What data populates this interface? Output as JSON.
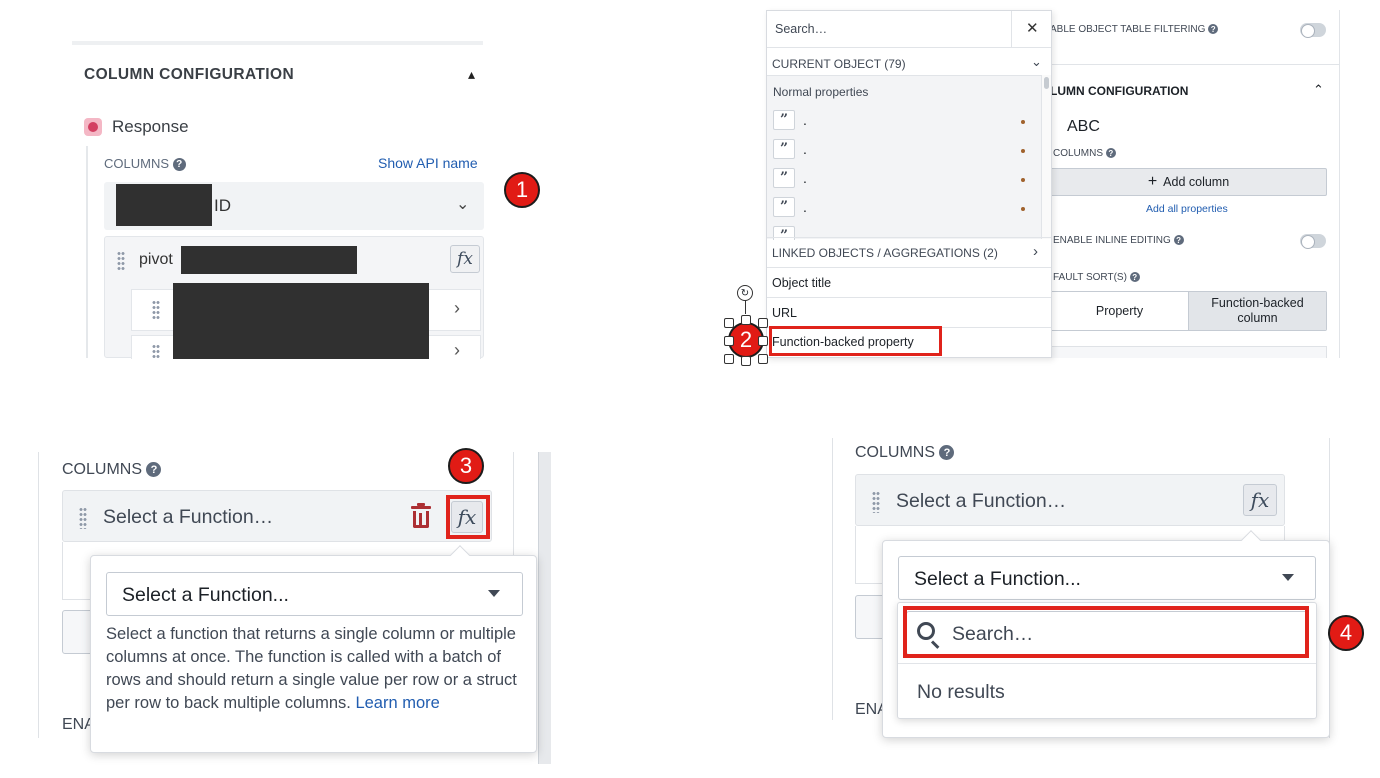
{
  "panel1": {
    "section_title": "COLUMN CONFIGURATION",
    "object_name": "Response",
    "columns_label": "COLUMNS",
    "show_api_name": "Show API name",
    "select_value_suffix": "ID",
    "pivot_label": "pivot",
    "fx_label": "fx",
    "badge": "1"
  },
  "panel2": {
    "search_placeholder": "Search…",
    "current_object": "CURRENT OBJECT (79)",
    "normal_properties": "Normal properties",
    "property_items": [
      ".",
      ".",
      ".",
      "."
    ],
    "linked_objects": "LINKED OBJECTS / AGGREGATIONS (2)",
    "object_title": "Object title",
    "url": "URL",
    "function_backed_property": "Function-backed property",
    "filter_label": "ABLE OBJECT TABLE FILTERING",
    "column_config": "LUMN CONFIGURATION",
    "abc": "ABC",
    "columns_label": "COLUMNS",
    "add_column": "Add column",
    "add_all": "Add all properties",
    "inline_editing": "ENABLE INLINE EDITING",
    "default_sorts": "FAULT SORT(S)",
    "seg_property": "Property",
    "seg_function_line1": "Function-backed",
    "seg_function_line2": "column",
    "badge": "2"
  },
  "panel3": {
    "columns_label": "COLUMNS",
    "select_function": "Select a Function…",
    "dropdown_value": "Select a Function...",
    "description": "Select a function that returns a single column or multiple columns at once. The function is called with a batch of rows and should return a single value per row or a struct per row to back multiple columns.",
    "learn_more": "Learn more",
    "ena_fragment": "ENA",
    "fx_label": "fx",
    "badge": "3"
  },
  "panel4": {
    "columns_label": "COLUMNS",
    "select_function": "Select a Function…",
    "dropdown_value": "Select a Function...",
    "search_placeholder": "Search…",
    "no_results": "No results",
    "ena_fragment": "ENA",
    "fx_label": "fx",
    "badge": "4"
  },
  "icons": [
    "help-icon",
    "chevron-up-icon",
    "chevron-down-icon",
    "chevron-right-icon",
    "close-icon",
    "plus-icon",
    "trash-icon",
    "search-icon",
    "caret-down-icon",
    "drag-handle-icon",
    "quote-icon",
    "rotate-icon"
  ],
  "colors": {
    "highlight": "#e0231b",
    "badge": "#e11b15",
    "link": "#215db0",
    "danger": "#ac2f33"
  }
}
